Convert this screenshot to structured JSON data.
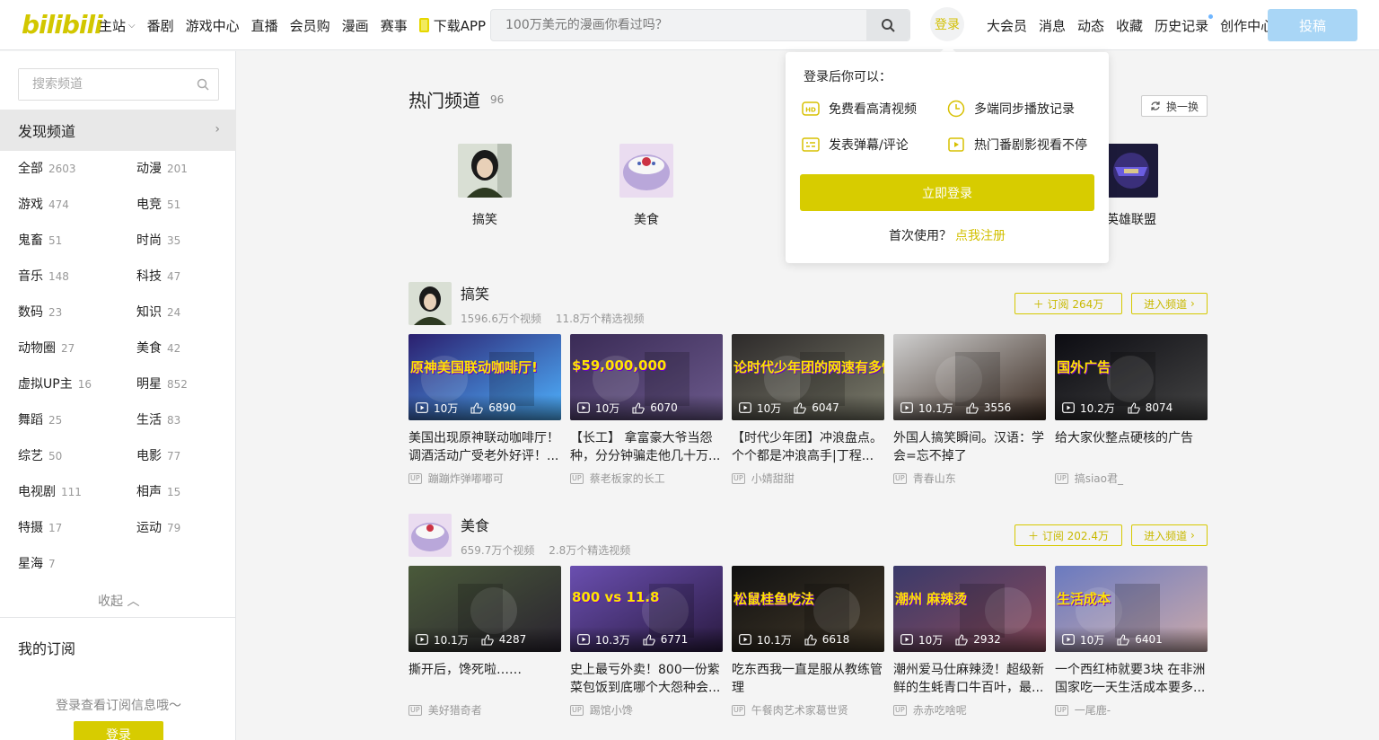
{
  "header": {
    "logo": "bilibili",
    "nav": [
      "主站",
      "番剧",
      "游戏中心",
      "直播",
      "会员购",
      "漫画",
      "赛事",
      "下载APP"
    ],
    "search_placeholder": "100万美元的漫画你看过吗？",
    "login": "登录",
    "right_nav": [
      "大会员",
      "消息",
      "动态",
      "收藏",
      "历史记录",
      "创作中心"
    ],
    "upload": "投稿",
    "colors": {
      "brand": "#d7cc00",
      "upload": "#a9d6f6"
    }
  },
  "sidebar": {
    "search_placeholder": "搜索频道",
    "discover": "发现频道",
    "categories": [
      {
        "name": "全部",
        "count": "2603"
      },
      {
        "name": "动漫",
        "count": "201"
      },
      {
        "name": "游戏",
        "count": "474"
      },
      {
        "name": "电竞",
        "count": "51"
      },
      {
        "name": "鬼畜",
        "count": "51"
      },
      {
        "name": "时尚",
        "count": "35"
      },
      {
        "name": "音乐",
        "count": "148"
      },
      {
        "name": "科技",
        "count": "47"
      },
      {
        "name": "数码",
        "count": "23"
      },
      {
        "name": "知识",
        "count": "24"
      },
      {
        "name": "动物圈",
        "count": "27"
      },
      {
        "name": "美食",
        "count": "42"
      },
      {
        "name": "虚拟UP主",
        "count": "16"
      },
      {
        "name": "明星",
        "count": "852"
      },
      {
        "name": "舞蹈",
        "count": "25"
      },
      {
        "name": "生活",
        "count": "83"
      },
      {
        "name": "综艺",
        "count": "50"
      },
      {
        "name": "电影",
        "count": "77"
      },
      {
        "name": "电视剧",
        "count": "111"
      },
      {
        "name": "相声",
        "count": "15"
      },
      {
        "name": "特摄",
        "count": "17"
      },
      {
        "name": "运动",
        "count": "79"
      },
      {
        "name": "星海",
        "count": "7"
      }
    ],
    "collapse": "收起",
    "my_sub": "我的订阅",
    "sub_tip": "登录查看订阅信息哦～",
    "login_btn": "登录"
  },
  "hot": {
    "title": "热门频道",
    "count": "96",
    "refresh": "换一换",
    "channels": [
      {
        "name": "搞笑"
      },
      {
        "name": "美食"
      },
      {
        "name": "英雄联盟"
      }
    ]
  },
  "popup": {
    "head": "登录后你可以：",
    "perks": [
      "免费看高清视频",
      "多端同步播放记录",
      "发表弹幕/评论",
      "热门番剧影视看不停"
    ],
    "login_btn": "立即登录",
    "first_use": "首次使用？",
    "register": "点我注册"
  },
  "sections": [
    {
      "name": "搞笑",
      "videos_count": "1596.6万个视频",
      "featured_count": "11.8万个精选视频",
      "subscribe": "订阅 264万",
      "enter": "进入频道",
      "cards": [
        {
          "title": "美国出现原神联动咖啡厅！调酒活动广受老外好评！...",
          "views": "10万",
          "likes": "6890",
          "up": "蹦蹦炸弹嘟嘟可",
          "overlay": "原神美国联动咖啡厅!"
        },
        {
          "title": "【长工】 拿富豪大爷当怨种，分分钟骗走他几十万...",
          "views": "10万",
          "likes": "6070",
          "up": "蔡老板家的长工",
          "overlay": "$59,000,000"
        },
        {
          "title": "【时代少年团】冲浪盘点。个个都是冲浪高手|丁程...",
          "views": "10万",
          "likes": "6047",
          "up": "小婧甜甜",
          "overlay": "论时代少年团的网速有多快"
        },
        {
          "title": "外国人搞笑瞬间。汉语：学会=忘不掉了",
          "views": "10.1万",
          "likes": "3556",
          "up": "青春山东",
          "overlay": ""
        },
        {
          "title": "给大家伙整点硬核的广告",
          "views": "10.2万",
          "likes": "8074",
          "up": "搞siao君_",
          "overlay": "国外广告"
        }
      ]
    },
    {
      "name": "美食",
      "videos_count": "659.7万个视频",
      "featured_count": "2.8万个精选视频",
      "subscribe": "订阅 202.4万",
      "enter": "进入频道",
      "cards": [
        {
          "title": "撕开后，馋死啦……",
          "views": "10.1万",
          "likes": "4287",
          "up": "美好猎奇者",
          "overlay": ""
        },
        {
          "title": "史上最亏外卖！800一份紫菜包饭到底哪个大怨种会...",
          "views": "10.3万",
          "likes": "6771",
          "up": "踢馆小馋",
          "overlay": "800 vs 11.8"
        },
        {
          "title": "吃东西我一直是服从教练管理",
          "views": "10.1万",
          "likes": "6618",
          "up": "午餐肉艺术家葛世贤",
          "overlay": "松鼠桂鱼吃法"
        },
        {
          "title": "潮州爱马仕麻辣烫！超级新鲜的生蚝青口牛百叶，最...",
          "views": "10万",
          "likes": "2932",
          "up": "赤赤吃啥呢",
          "overlay": "潮州 麻辣烫"
        },
        {
          "title": "一个西红柿就要3块 在非洲国家吃一天生活成本要多...",
          "views": "10万",
          "likes": "6401",
          "up": "一尾鹿-",
          "overlay": "生活成本"
        }
      ]
    }
  ]
}
